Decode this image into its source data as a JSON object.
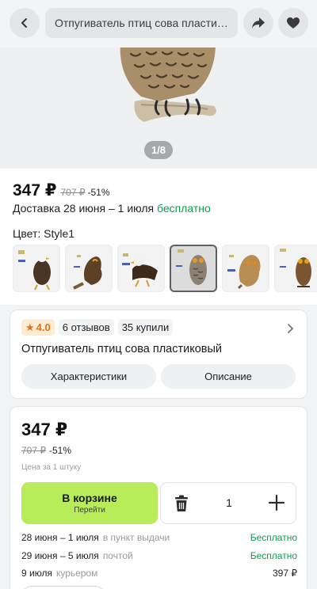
{
  "header": {
    "search_text": "Отпугиватель птиц сова пластико...",
    "back_icon": "chevron-left-icon",
    "share_icon": "share-arrow-icon",
    "favorite_icon": "heart-icon"
  },
  "gallery": {
    "counter": "1/8"
  },
  "price": {
    "current": "347 ₽",
    "old": "707 ₽",
    "discount": "-51%"
  },
  "delivery": {
    "text": "Доставка 28 июня – 1 июля",
    "free_label": "бесплатно"
  },
  "color": {
    "label": "Цвет: Style1",
    "options": [
      "eagle",
      "owl-brown",
      "eagle-flying",
      "owl-grey",
      "owl-light",
      "owl-standing"
    ],
    "selected_index": 3
  },
  "summary": {
    "rating": "4.0",
    "reviews": "6 отзывов",
    "bought": "35 купили",
    "title": "Отпугиватель птиц сова пластиковый",
    "tab_specs": "Характеристики",
    "tab_description": "Описание"
  },
  "buy": {
    "price": "347 ₽",
    "old_price": "707 ₽",
    "discount": "-51%",
    "unit_note": "Цена за 1 штуку",
    "cart_label": "В корзине",
    "cart_sub": "Перейти",
    "quantity": "1"
  },
  "delivery_options": [
    {
      "date": "28 июня – 1 июля",
      "method": "в пункт выдачи",
      "cost": "Бесплатно"
    },
    {
      "date": "29 июня – 5 июля",
      "method": "почтой",
      "cost": "Бесплатно"
    },
    {
      "date": "9 июля",
      "method": "курьером",
      "cost": "397 ₽"
    }
  ],
  "colors": {
    "accent_green": "#b8ec58",
    "free_green": "#0ba04c",
    "star_orange": "#e0731a"
  }
}
